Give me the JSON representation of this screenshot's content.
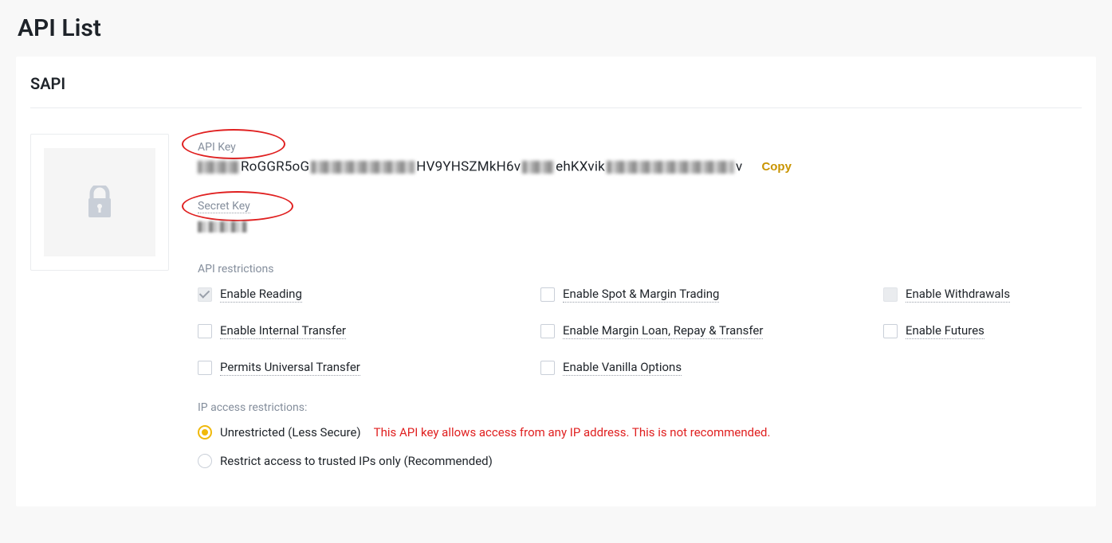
{
  "page_title": "API List",
  "api_section_label": "SAPI",
  "api_key": {
    "label": "API Key",
    "value_visible_fragments": [
      "RoGGR5oG",
      "HV9YHSZMkH6v",
      "ehKXvik",
      "v"
    ],
    "copy_label": "Copy"
  },
  "secret_key": {
    "label": "Secret Key"
  },
  "restrictions": {
    "title": "API restrictions",
    "items": [
      {
        "label": "Enable Reading",
        "checked": true,
        "locked": true
      },
      {
        "label": "Enable Spot & Margin Trading",
        "checked": false,
        "locked": false
      },
      {
        "label": "Enable Withdrawals",
        "checked": false,
        "locked": true
      },
      {
        "label": "Enable Internal Transfer",
        "checked": false,
        "locked": false
      },
      {
        "label": "Enable Margin Loan, Repay & Transfer",
        "checked": false,
        "locked": false
      },
      {
        "label": "Enable Futures",
        "checked": false,
        "locked": false
      },
      {
        "label": "Permits Universal Transfer",
        "checked": false,
        "locked": false
      },
      {
        "label": "Enable Vanilla Options",
        "checked": false,
        "locked": false
      }
    ]
  },
  "ip_access": {
    "title": "IP access restrictions:",
    "options": [
      {
        "label": "Unrestricted (Less Secure)",
        "selected": true,
        "warning": "This API key allows access from any IP address. This is not recommended."
      },
      {
        "label": "Restrict access to trusted IPs only (Recommended)",
        "selected": false
      }
    ]
  }
}
